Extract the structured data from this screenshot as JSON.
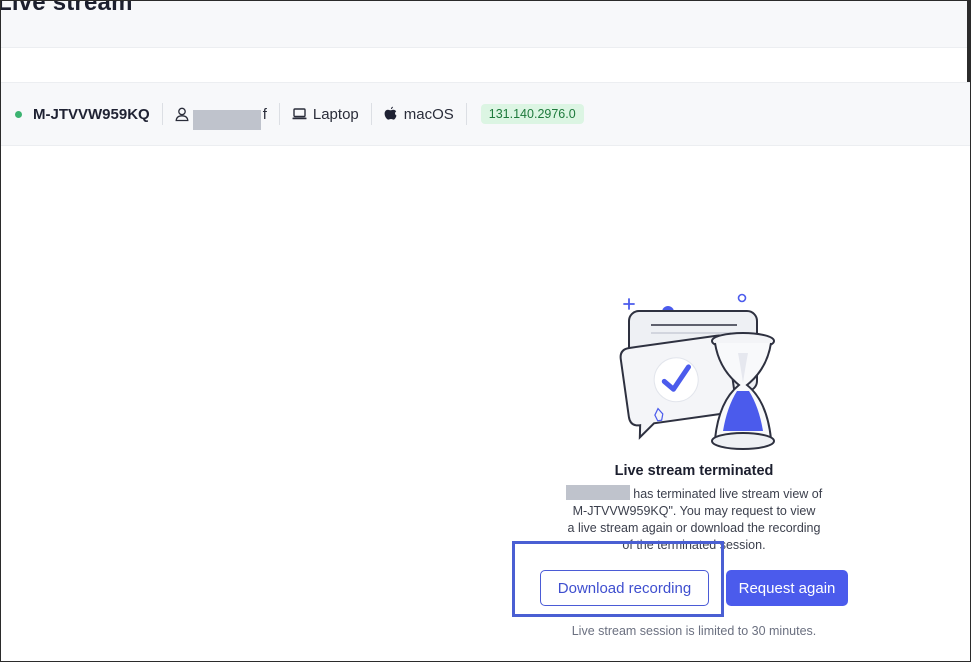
{
  "page": {
    "title": "Live stream"
  },
  "device": {
    "status": "online",
    "id": "M-JTVVW959KQ",
    "user_suffix": "f",
    "type": "Laptop",
    "os": "macOS",
    "version": "131.140.2976.0"
  },
  "empty_state": {
    "title": "Live stream terminated",
    "line1": " has terminated live stream view of",
    "line2": "M-JTVVW959KQ\". You may request to view",
    "line3": "a live stream again or download the recording",
    "line4": "of the terminated session."
  },
  "actions": {
    "download_label": "Download recording",
    "request_label": "Request again"
  },
  "footnote": "Live stream session is limited to 30 minutes.",
  "colors": {
    "primary": "#4b5bec",
    "status_online": "#3cb371",
    "badge_bg": "#dcf5e3",
    "badge_text": "#1e7a3c",
    "highlight": "#4a5fd3"
  },
  "icons": [
    "user-icon",
    "laptop-icon",
    "apple-icon"
  ]
}
